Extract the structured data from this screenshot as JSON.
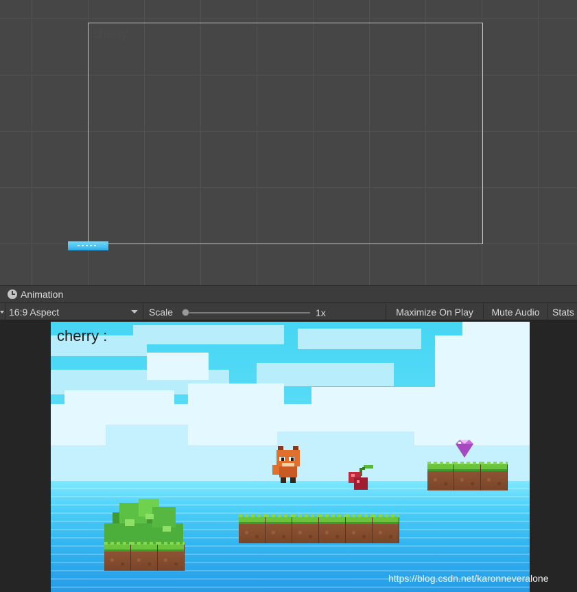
{
  "scene": {
    "canvas_label": "cherry :"
  },
  "tab": {
    "label": "Animation",
    "icon": "clock-icon"
  },
  "toolbar": {
    "aspect": "16:9 Aspect",
    "scale_label": "Scale",
    "scale_value": "1x",
    "scale_fraction": 0,
    "maximize": "Maximize On Play",
    "mute": "Mute Audio",
    "stats": "Stats"
  },
  "game": {
    "cherry_label": "cherry :",
    "watermark": "https://blog.csdn.net/karonneveralone"
  },
  "colors": {
    "editor_bg": "#464646",
    "toolbar_bg": "#3c3c3c",
    "sky": "#46d6f4",
    "sea": "#34b6f0"
  }
}
